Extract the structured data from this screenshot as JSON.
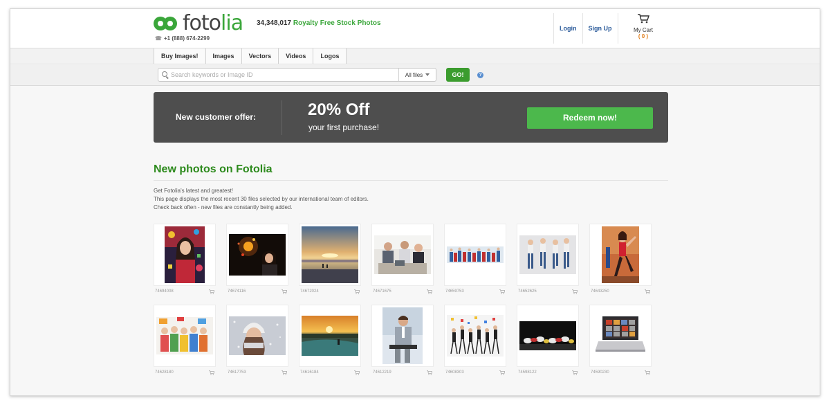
{
  "header": {
    "logo": {
      "text_a": "foto",
      "text_b": "lia"
    },
    "phone": "+1 (888) 674-2299",
    "tagline": {
      "count": "34,348,017",
      "text": "Royalty Free Stock Photos"
    },
    "links": {
      "login": "Login",
      "signup": "Sign Up"
    },
    "cart": {
      "label": "My Cart",
      "count": "( 0 )",
      "count_color": "#e07a14"
    }
  },
  "nav": {
    "tabs": [
      "Buy Images!",
      "Images",
      "Vectors",
      "Videos",
      "Logos"
    ]
  },
  "search": {
    "placeholder": "Search keywords or Image ID",
    "filter": "All files",
    "go": "GO!",
    "help": "?"
  },
  "banner": {
    "label": "New customer offer:",
    "headline": "20% Off",
    "subline": "your first purchase!",
    "button": "Redeem now!",
    "button_color": "#4cb84c"
  },
  "section": {
    "title": "New photos on Fotolia",
    "title_color": "#2e8b1e",
    "lines": [
      "Get Fotolia's latest and greatest!",
      "This page displays the most recent 30 files selected by our international team of editors.",
      "Check back often - new files are constantly being added."
    ]
  },
  "photos": [
    {
      "id": "74694008",
      "subject": "woman-party"
    },
    {
      "id": "74674116",
      "subject": "woman-lightbulb"
    },
    {
      "id": "74672024",
      "subject": "sunset-beach"
    },
    {
      "id": "74671675",
      "subject": "business-meeting"
    },
    {
      "id": "74659753",
      "subject": "people-panorama"
    },
    {
      "id": "74652625",
      "subject": "group-jumping"
    },
    {
      "id": "74643250",
      "subject": "woman-dancer"
    },
    {
      "id": "74628180",
      "subject": "children-group"
    },
    {
      "id": "74617753",
      "subject": "woman-winter"
    },
    {
      "id": "74616184",
      "subject": "sunset-lake"
    },
    {
      "id": "74612219",
      "subject": "businessman-laptop"
    },
    {
      "id": "74608303",
      "subject": "crowd-celebrating"
    },
    {
      "id": "74598122",
      "subject": "shoes-row"
    },
    {
      "id": "74590230",
      "subject": "laptop-photos"
    }
  ]
}
